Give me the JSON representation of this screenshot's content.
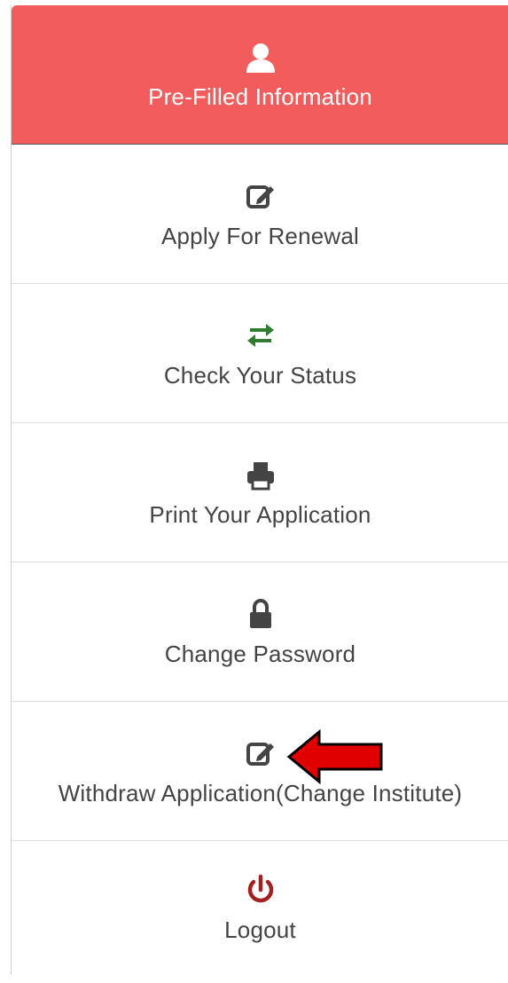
{
  "menu": {
    "items": [
      {
        "label": "Pre-Filled Information",
        "icon": "user-icon",
        "active": true
      },
      {
        "label": "Apply For Renewal",
        "icon": "edit-icon"
      },
      {
        "label": "Check Your Status",
        "icon": "exchange-arrows-icon"
      },
      {
        "label": "Print Your Application",
        "icon": "printer-icon"
      },
      {
        "label": "Change Password",
        "icon": "lock-icon"
      },
      {
        "label": "Withdraw Application(Change Institute)",
        "icon": "edit-icon"
      },
      {
        "label": "Logout",
        "icon": "power-icon"
      }
    ]
  },
  "colors": {
    "active_bg": "#f25c5c",
    "status_icon": "#2e7d32",
    "logout_icon": "#a32020",
    "arrow": "#e00000"
  }
}
